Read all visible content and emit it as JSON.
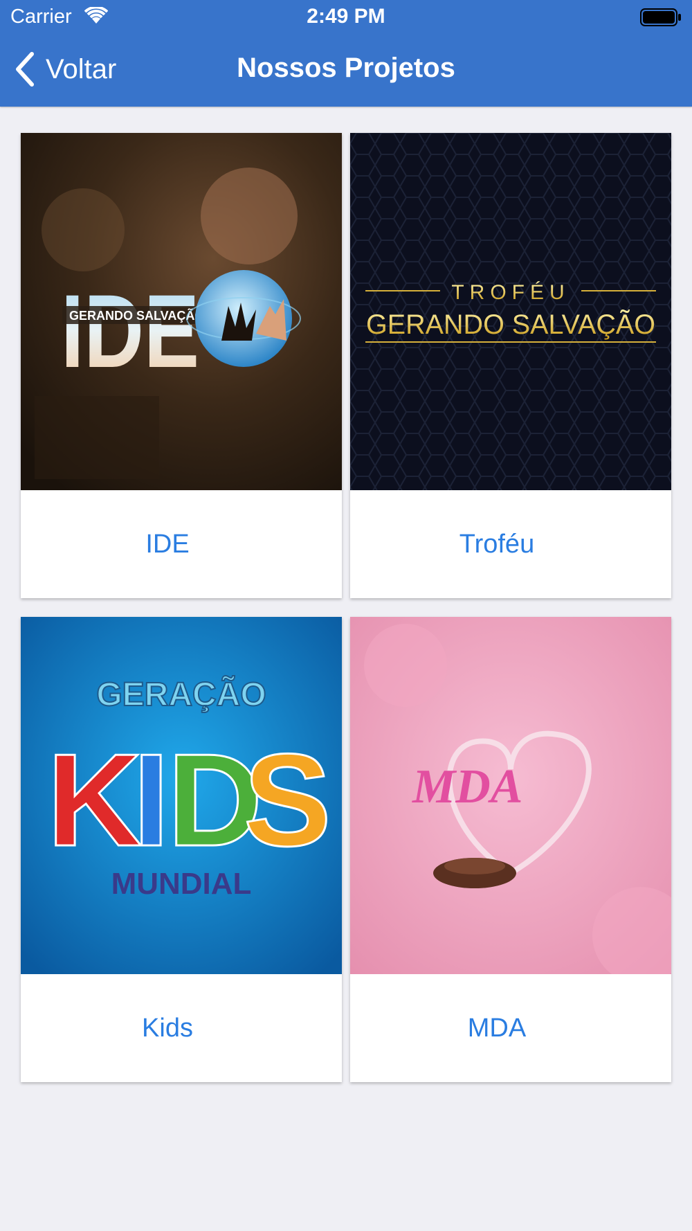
{
  "status_bar": {
    "carrier": "Carrier",
    "time": "2:49 PM"
  },
  "nav": {
    "back_label": "Voltar",
    "title": "Nossos Projetos"
  },
  "colors": {
    "nav": "#3874cb",
    "link": "#2a7de1",
    "background": "#efeff4"
  },
  "projects": [
    {
      "label": "IDE",
      "art": {
        "line1": "IDE",
        "line2": "GERANDO SALVAÇÃO"
      }
    },
    {
      "label": "Troféu",
      "art": {
        "line1": "TROFÉU",
        "line2": "GERANDO SALVAÇÃO"
      }
    },
    {
      "label": "Kids",
      "art": {
        "line1": "GERAÇÃO",
        "line2": "KIDS",
        "line3": "MUNDIAL"
      }
    },
    {
      "label": "MDA",
      "art": {
        "line1": "MDA"
      }
    }
  ]
}
